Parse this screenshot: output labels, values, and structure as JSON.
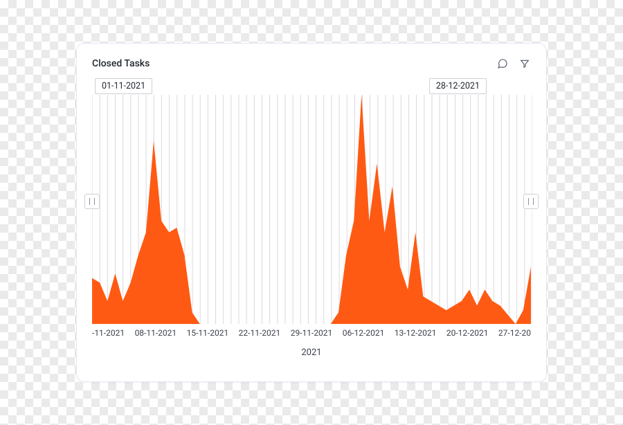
{
  "title": "Closed Tasks",
  "range": {
    "start": "01-11-2021",
    "end": "28-12-2021"
  },
  "x_ticks": [
    "-11-2021",
    "08-11-2021",
    "15-11-2021",
    "22-11-2021",
    "29-11-2021",
    "06-12-2021",
    "13-12-2021",
    "20-12-2021",
    "27-12-20"
  ],
  "chart_data": {
    "type": "area",
    "title": "Closed Tasks",
    "xlabel": "2021",
    "ylabel": "",
    "ylim": [
      0,
      100
    ],
    "x": [
      "01-11-2021",
      "02-11-2021",
      "03-11-2021",
      "04-11-2021",
      "05-11-2021",
      "06-11-2021",
      "07-11-2021",
      "08-11-2021",
      "09-11-2021",
      "10-11-2021",
      "11-11-2021",
      "12-11-2021",
      "13-11-2021",
      "14-11-2021",
      "15-11-2021",
      "16-11-2021",
      "17-11-2021",
      "18-11-2021",
      "19-11-2021",
      "20-11-2021",
      "21-11-2021",
      "22-11-2021",
      "23-11-2021",
      "24-11-2021",
      "25-11-2021",
      "26-11-2021",
      "27-11-2021",
      "28-11-2021",
      "29-11-2021",
      "30-11-2021",
      "01-12-2021",
      "02-12-2021",
      "03-12-2021",
      "04-12-2021",
      "05-12-2021",
      "06-12-2021",
      "07-12-2021",
      "08-12-2021",
      "09-12-2021",
      "10-12-2021",
      "11-12-2021",
      "12-12-2021",
      "13-12-2021",
      "14-12-2021",
      "15-12-2021",
      "16-12-2021",
      "17-12-2021",
      "18-12-2021",
      "19-12-2021",
      "20-12-2021",
      "21-12-2021",
      "22-12-2021",
      "23-12-2021",
      "24-12-2021",
      "25-12-2021",
      "26-12-2021",
      "27-12-2021",
      "28-12-2021"
    ],
    "values": [
      20,
      18,
      10,
      22,
      10,
      18,
      30,
      40,
      80,
      45,
      40,
      42,
      30,
      5,
      0,
      0,
      0,
      0,
      0,
      0,
      0,
      0,
      0,
      0,
      0,
      0,
      0,
      0,
      0,
      0,
      0,
      0,
      5,
      30,
      45,
      100,
      45,
      70,
      40,
      60,
      25,
      15,
      40,
      12,
      10,
      8,
      6,
      8,
      10,
      15,
      8,
      15,
      10,
      8,
      4,
      0,
      6,
      25
    ],
    "series_color": "#ff5a13"
  }
}
